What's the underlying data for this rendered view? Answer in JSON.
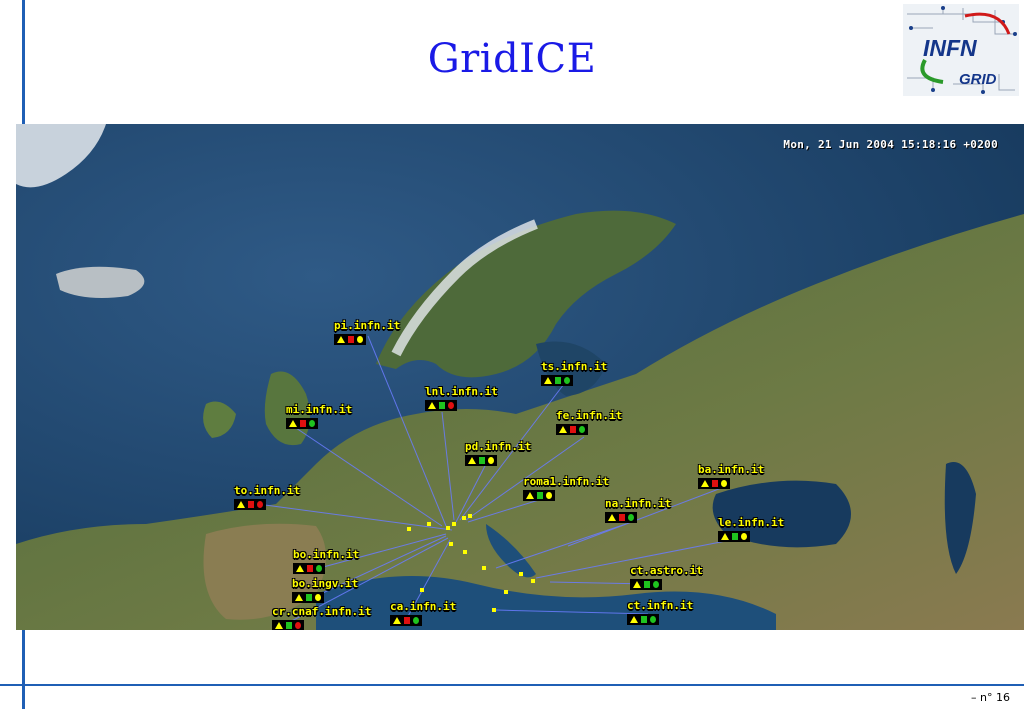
{
  "slide": {
    "title": "GridICE",
    "page_number": "– n° 16"
  },
  "logo": {
    "text_top": "INFN",
    "text_bottom": "GRID"
  },
  "map": {
    "timestamp": "Mon, 21 Jun 2004 15:18:16 +0200",
    "sites": [
      {
        "id": "pi",
        "label": "pi.infn.it",
        "status": [
          "#ffff00",
          "#e01010",
          "#ffff00"
        ]
      },
      {
        "id": "ts",
        "label": "ts.infn.it",
        "status": [
          "#ffff00",
          "#1fc31f",
          "#1fc31f"
        ]
      },
      {
        "id": "lnl",
        "label": "lnl.infn.it",
        "status": [
          "#ffff00",
          "#1fc31f",
          "#e01010"
        ]
      },
      {
        "id": "mi",
        "label": "mi.infn.it",
        "status": [
          "#ffff00",
          "#e01010",
          "#1fc31f"
        ]
      },
      {
        "id": "fe",
        "label": "fe.infn.it",
        "status": [
          "#ffff00",
          "#e01010",
          "#1fc31f"
        ]
      },
      {
        "id": "pd",
        "label": "pd.infn.it",
        "status": [
          "#ffff00",
          "#1fc31f",
          "#ffff00"
        ]
      },
      {
        "id": "ba",
        "label": "ba.infn.it",
        "status": [
          "#ffff00",
          "#e01010",
          "#ffff00"
        ]
      },
      {
        "id": "roma1",
        "label": "roma1.infn.it",
        "status": [
          "#ffff00",
          "#1fc31f",
          "#ffff00"
        ]
      },
      {
        "id": "to",
        "label": "to.infn.it",
        "status": [
          "#ffff00",
          "#e01010",
          "#e01010"
        ]
      },
      {
        "id": "na",
        "label": "na.infn.it",
        "status": [
          "#ffff00",
          "#e01010",
          "#1fc31f"
        ]
      },
      {
        "id": "le",
        "label": "le.infn.it",
        "status": [
          "#ffff00",
          "#1fc31f",
          "#ffff00"
        ]
      },
      {
        "id": "bo",
        "label": "bo.infn.it",
        "status": [
          "#ffff00",
          "#e01010",
          "#1fc31f"
        ]
      },
      {
        "id": "bo_ingv",
        "label": "bo.ingv.it",
        "status": [
          "#ffff00",
          "#1fc31f",
          "#ffff00"
        ]
      },
      {
        "id": "ct_astro",
        "label": "ct.astro.it",
        "status": [
          "#ffff00",
          "#1fc31f",
          "#1fc31f"
        ]
      },
      {
        "id": "cr_cnaf",
        "label": "cr.cnaf.infn.it",
        "status": [
          "#ffff00",
          "#1fc31f",
          "#e01010"
        ]
      },
      {
        "id": "ca",
        "label": "ca.infn.it",
        "status": [
          "#ffff00",
          "#e01010",
          "#1fc31f"
        ]
      },
      {
        "id": "ct",
        "label": "ct.infn.it",
        "status": [
          "#ffff00",
          "#1fc31f",
          "#1fc31f"
        ]
      }
    ]
  }
}
